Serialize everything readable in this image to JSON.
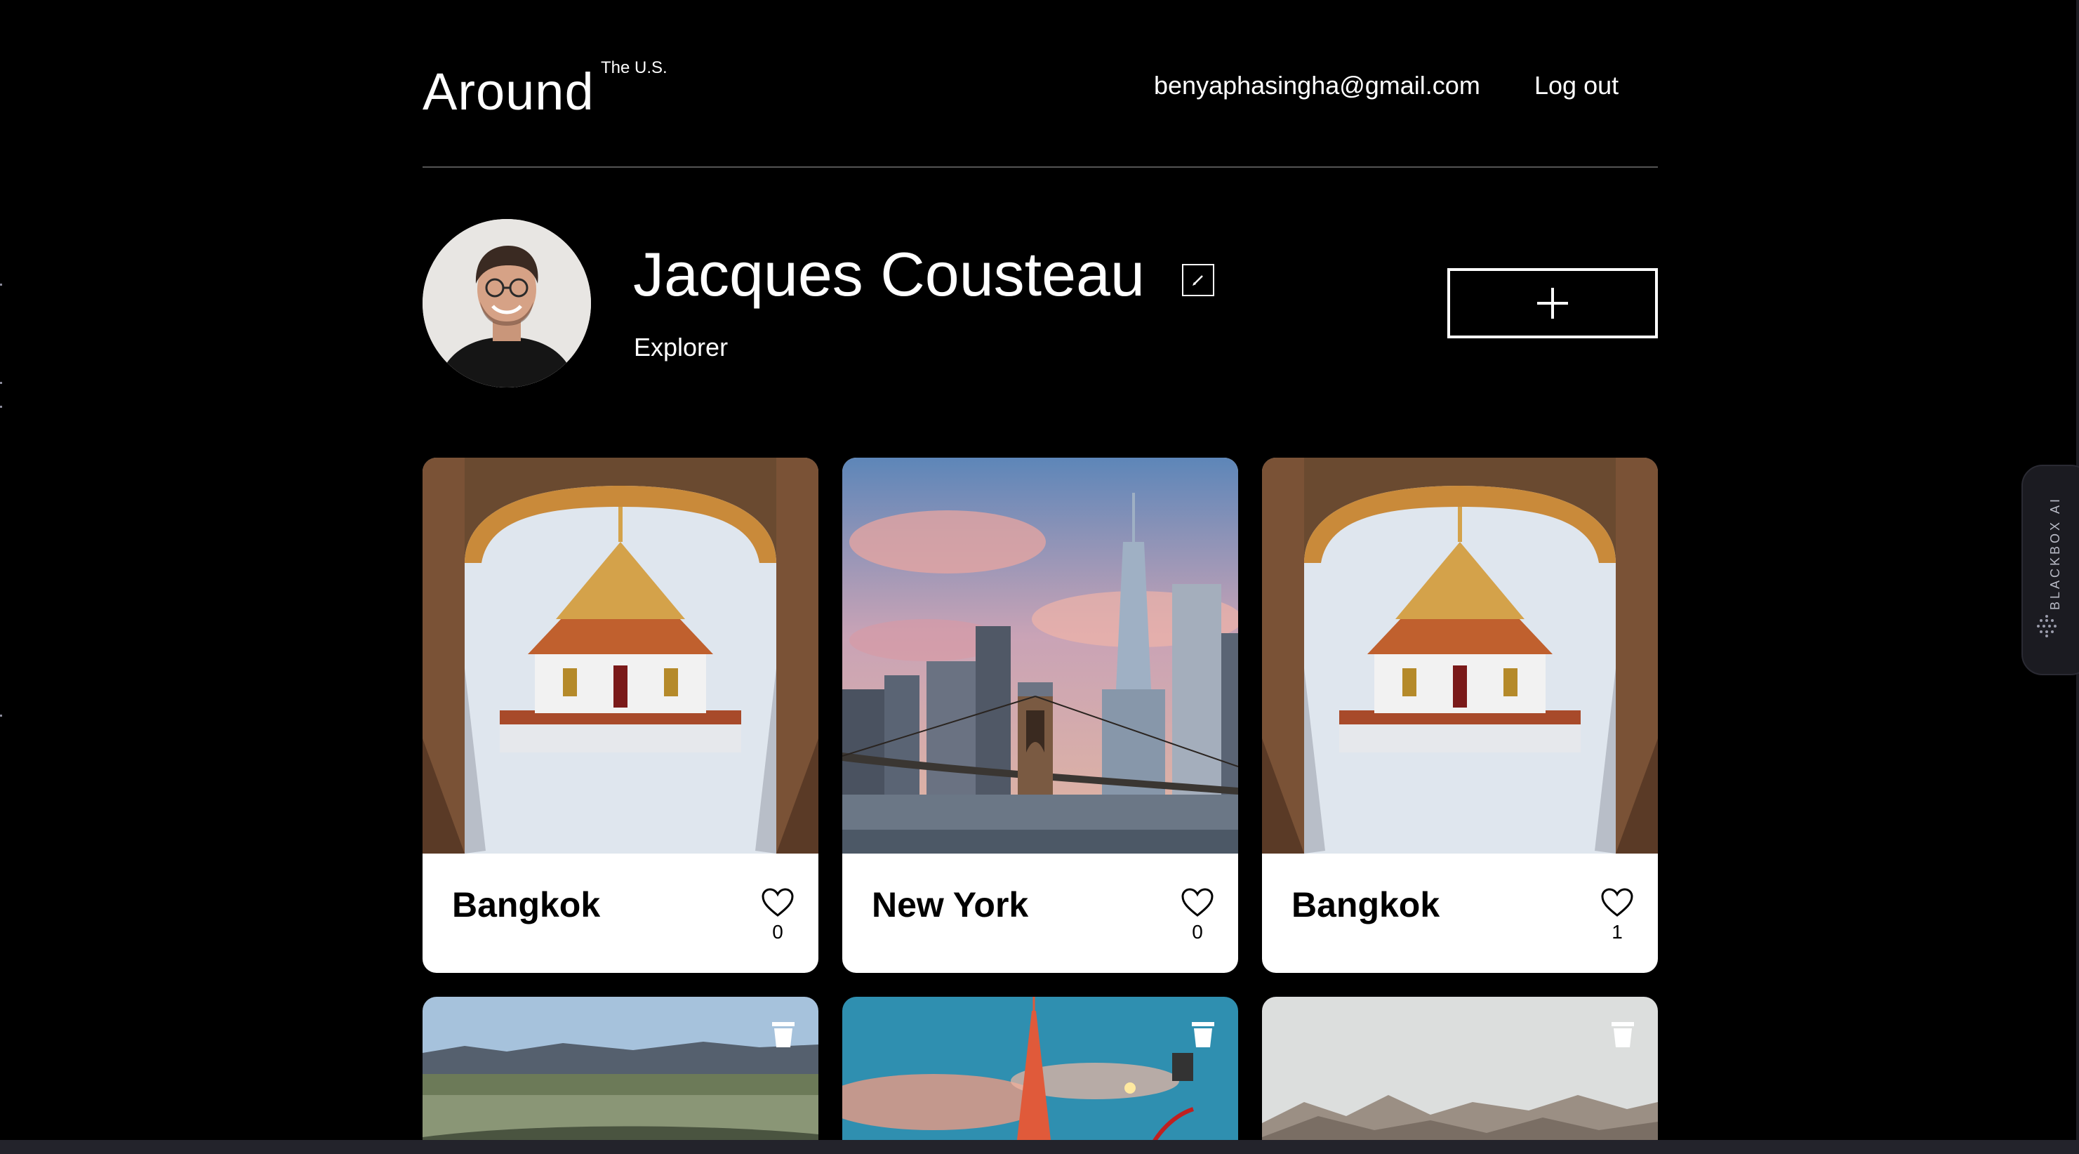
{
  "header": {
    "logo": "Around",
    "logo_superscript": "The U.S.",
    "email": "benyaphasingha@gmail.com",
    "logout_label": "Log out"
  },
  "profile": {
    "name": "Jacques Cousteau",
    "job": "Explorer",
    "avatar_icon": "profile-photo",
    "edit_icon": "pencil-icon",
    "add_icon": "plus-icon"
  },
  "cards": [
    {
      "title": "Bangkok",
      "likes": "0",
      "image": "temple-photo"
    },
    {
      "title": "New York",
      "likes": "0",
      "image": "skyline-bridge-photo"
    },
    {
      "title": "Bangkok",
      "likes": "1",
      "image": "temple-photo"
    }
  ],
  "partial_cards": [
    {
      "image": "valley-city-photo",
      "icon": "trash-icon"
    },
    {
      "image": "tokyo-tower-photo",
      "icon": "trash-icon"
    },
    {
      "image": "great-wall-photo",
      "icon": "trash-icon"
    }
  ],
  "extension": {
    "label": "BLACKBOX AI"
  },
  "colors": {
    "background": "#000000",
    "card": "#ffffff",
    "text_light": "#ffffff",
    "text_dark": "#000000"
  }
}
